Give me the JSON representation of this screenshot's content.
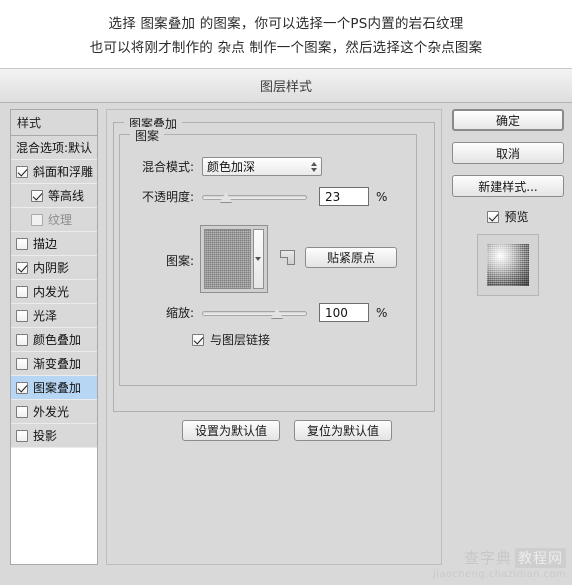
{
  "caption": {
    "line1": "选择 图案叠加 的图案，你可以选择一个PS内置的岩石纹理",
    "line2": "也可以将刚才制作的 杂点 制作一个图案，然后选择这个杂点图案"
  },
  "dialog": {
    "title": "图层样式"
  },
  "styles_panel": {
    "header": "样式",
    "items": [
      {
        "label": "混合选项:默认",
        "checkbox": false,
        "has_checkbox": false,
        "sub": false,
        "selected": false,
        "dim": false
      },
      {
        "label": "斜面和浮雕",
        "checkbox": true,
        "has_checkbox": true,
        "sub": false,
        "selected": false,
        "dim": false
      },
      {
        "label": "等高线",
        "checkbox": true,
        "has_checkbox": true,
        "sub": true,
        "selected": false,
        "dim": false
      },
      {
        "label": "纹理",
        "checkbox": false,
        "has_checkbox": true,
        "sub": true,
        "selected": false,
        "dim": true
      },
      {
        "label": "描边",
        "checkbox": false,
        "has_checkbox": true,
        "sub": false,
        "selected": false,
        "dim": false
      },
      {
        "label": "内阴影",
        "checkbox": true,
        "has_checkbox": true,
        "sub": false,
        "selected": false,
        "dim": false
      },
      {
        "label": "内发光",
        "checkbox": false,
        "has_checkbox": true,
        "sub": false,
        "selected": false,
        "dim": false
      },
      {
        "label": "光泽",
        "checkbox": false,
        "has_checkbox": true,
        "sub": false,
        "selected": false,
        "dim": false
      },
      {
        "label": "颜色叠加",
        "checkbox": false,
        "has_checkbox": true,
        "sub": false,
        "selected": false,
        "dim": false
      },
      {
        "label": "渐变叠加",
        "checkbox": false,
        "has_checkbox": true,
        "sub": false,
        "selected": false,
        "dim": false
      },
      {
        "label": "图案叠加",
        "checkbox": true,
        "has_checkbox": true,
        "sub": false,
        "selected": true,
        "dim": false
      },
      {
        "label": "外发光",
        "checkbox": false,
        "has_checkbox": true,
        "sub": false,
        "selected": false,
        "dim": false
      },
      {
        "label": "投影",
        "checkbox": false,
        "has_checkbox": true,
        "sub": false,
        "selected": false,
        "dim": false
      }
    ]
  },
  "main": {
    "group_title": "图案叠加",
    "section_title": "图案",
    "blend_mode": {
      "label": "混合模式:",
      "value": "颜色加深"
    },
    "opacity": {
      "label": "不透明度:",
      "value": "23",
      "unit": "%",
      "percent": 23
    },
    "pattern": {
      "label": "图案:",
      "snap_button": "贴紧原点",
      "new_pattern_icon": "new-pattern-icon"
    },
    "scale": {
      "label": "缩放:",
      "value": "100",
      "unit": "%",
      "percent": 100
    },
    "link_layer": {
      "label": "与图层链接",
      "checked": true
    },
    "set_default_button": "设置为默认值",
    "reset_default_button": "复位为默认值"
  },
  "right_panel": {
    "ok_button": "确定",
    "cancel_button": "取消",
    "new_style_button": "新建样式...",
    "preview": {
      "label": "预览",
      "checked": true
    }
  },
  "watermark": {
    "brand": "查字典",
    "brand_tag": "教程网",
    "url": "jiaocheng.chazidian.com"
  },
  "colors": {
    "dialog_bg": "#d9d9d9",
    "selection_blue": "#b6d6f4",
    "list_bg": "#ffffff"
  }
}
